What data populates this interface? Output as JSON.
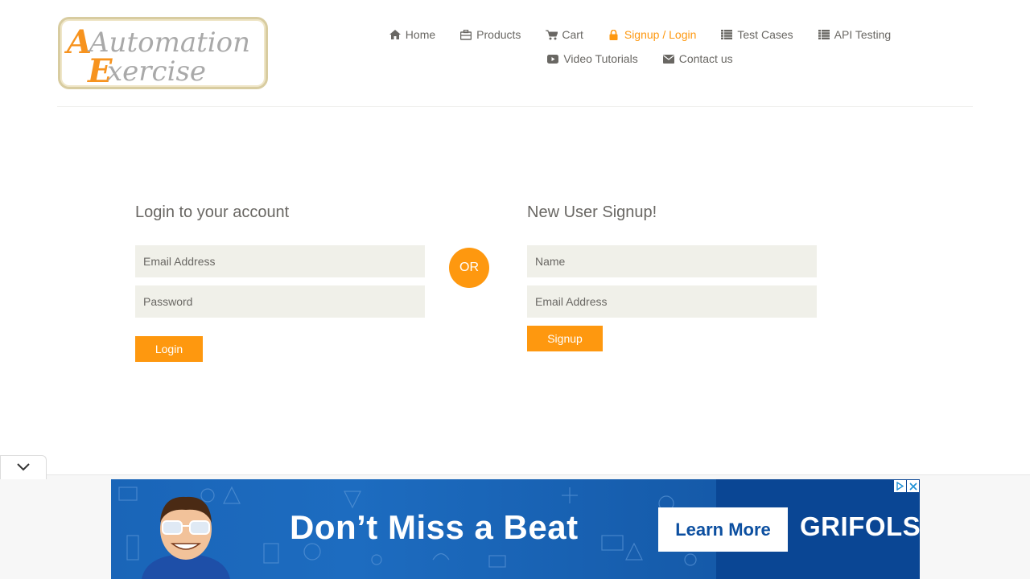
{
  "logo": {
    "line1": "Automation",
    "line2": "Exercise"
  },
  "nav": {
    "row1": [
      {
        "label": "Home",
        "icon": "home-icon"
      },
      {
        "label": "Products",
        "icon": "briefcase-icon"
      },
      {
        "label": "Cart",
        "icon": "cart-icon"
      },
      {
        "label": "Signup / Login",
        "icon": "lock-icon",
        "active": true
      },
      {
        "label": "Test Cases",
        "icon": "list-icon"
      },
      {
        "label": "API Testing",
        "icon": "list-icon"
      }
    ],
    "row2": [
      {
        "label": "Video Tutorials",
        "icon": "youtube-play-icon"
      },
      {
        "label": "Contact us",
        "icon": "envelope-icon"
      }
    ]
  },
  "login": {
    "title": "Login to your account",
    "email_placeholder": "Email Address",
    "password_placeholder": "Password",
    "button_label": "Login"
  },
  "divider": {
    "label": "OR"
  },
  "signup": {
    "title": "New User Signup!",
    "name_placeholder": "Name",
    "email_placeholder": "Email Address",
    "button_label": "Signup"
  },
  "ad": {
    "headline": "Don’t Miss a Beat",
    "cta": "Learn More",
    "brand": "GRIFOLS"
  },
  "colors": {
    "accent": "#fe980f",
    "text": "#696763",
    "field_bg": "#f0f0e9",
    "ad_blue": "#0c4fa0"
  }
}
